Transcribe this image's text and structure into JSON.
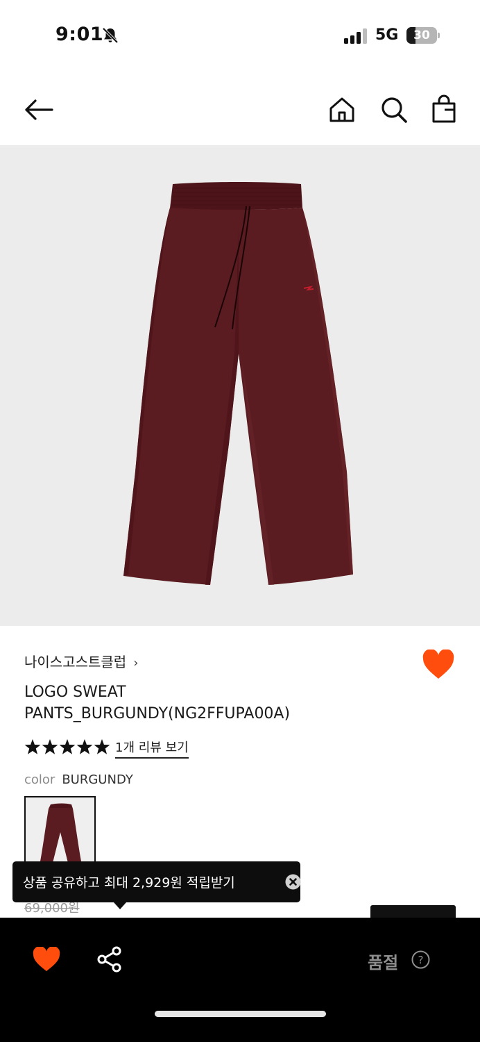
{
  "status_bar": {
    "time": "9:01",
    "network": "5G",
    "battery_level": "30",
    "battery_fraction": 0.3
  },
  "nav": {
    "back_icon": "arrow-left-icon",
    "home_icon": "home-icon",
    "search_icon": "search-icon",
    "cart_icon": "shopping-bag-icon"
  },
  "product": {
    "brand": "나이스고스트클럽",
    "brand_chevron": "›",
    "name_line1": "LOGO SWEAT",
    "name_line2": "PANTS_BURGUNDY(NG2FFUPA00A)",
    "rating_stars": 5,
    "review_link": "1개 리뷰 보기",
    "color_label": "color",
    "color_value": "BURGUNDY",
    "original_price": "69,000원",
    "wishlisted": true
  },
  "tooltip": {
    "text": "상품 공유하고 최대 2,929원 적립받기",
    "close_icon": "close-circle-icon"
  },
  "bottom_bar": {
    "heart_icon": "heart-icon",
    "share_icon": "share-icon",
    "status_label": "품절",
    "help_icon": "question-circle-icon"
  },
  "colors": {
    "accent_heart": "#ff4d0d",
    "product_burgundy": "#5a1c21",
    "hero_background": "#ececec",
    "bottom_bar": "#000000"
  }
}
